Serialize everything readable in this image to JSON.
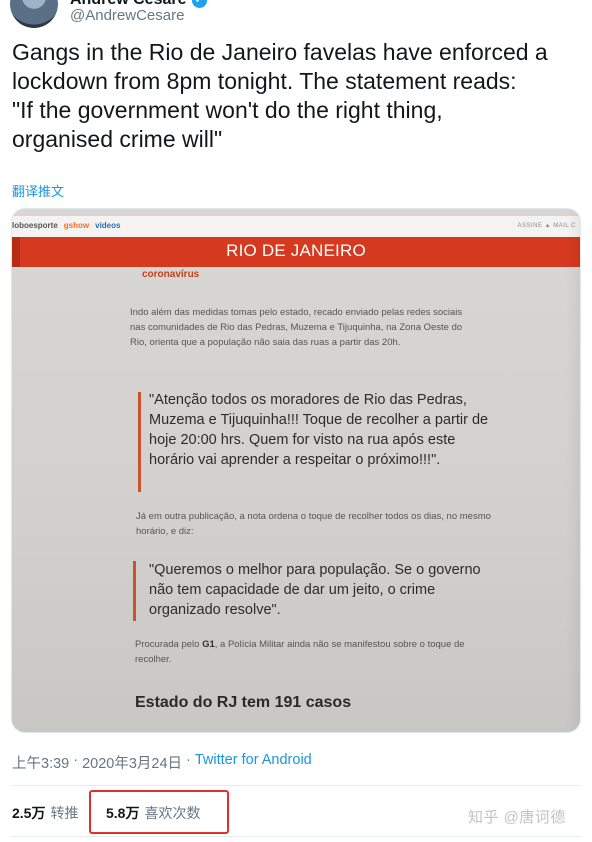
{
  "author": {
    "display_name": "Andrew Cesare",
    "verified_icon": "verified-badge-icon",
    "handle": "@AndrewCesare"
  },
  "tweet": {
    "text": "Gangs in the Rio de Janeiro favelas have enforced a\nlockdown from 8pm tonight. The statement reads:\n\"If the government won't do the right thing,\norganised crime will\"",
    "translate_label": "翻译推文"
  },
  "photo": {
    "site_links": [
      "loboesporte",
      "gshow",
      "videos"
    ],
    "site_right": "ASSINE ▲   MAIL C",
    "banner_title": "RIO DE JANEIRO",
    "kicker": "coronavírus",
    "paragraph1": "Indo além das medidas tomas pelo estado, recado enviado pelas redes sociais nas comunidades de Rio das Pedras, Muzema e Tijuquinha, na Zona Oeste do Rio, orienta que a população não saia das ruas a partir das 20h.",
    "quote1": "\"Atenção todos os moradores de Rio das Pedras, Muzema e Tijuquinha!!! Toque de recolher a partir de hoje 20:00 hrs. Quem for visto na rua após este horário vai aprender a respeitar o próximo!!!\".",
    "paragraph2": "Já em outra publicação, a nota ordena o toque de recolher todos os dias, no mesmo horário, e diz:",
    "quote2": "\"Queremos o melhor para população. Se o governo não tem capacidade de dar um jeito, o crime organizado resolve\".",
    "paragraph3_prefix": "Procurada pelo ",
    "paragraph3_bold": "G1",
    "paragraph3_suffix": ", a Polícia Militar ainda não se manifestou sobre o toque de recolher.",
    "headline": "Estado do RJ tem 191 casos"
  },
  "meta": {
    "time": "上午3:39",
    "sep1": "·",
    "date": "2020年3月24日",
    "sep2": "·",
    "source": "Twitter for Android"
  },
  "stats": {
    "retweets_count": "2.5万",
    "retweets_label": "转推",
    "likes_count": "5.8万",
    "likes_label": "喜欢次数"
  },
  "watermark": "知乎 @唐诃德",
  "colors": {
    "link": "#1b95e0",
    "banner": "#d5391f",
    "highlight_box": "#e0302b"
  }
}
